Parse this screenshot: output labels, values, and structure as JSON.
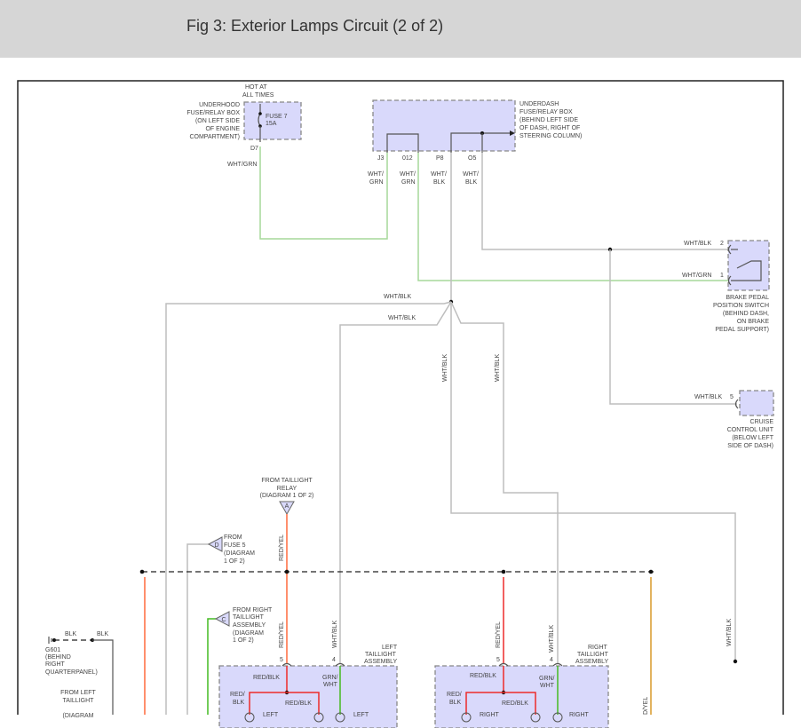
{
  "header": {
    "title": "Fig 3: Exterior Lamps Circuit (2 of 2)"
  },
  "diagram": {
    "underhood_box": {
      "hot": [
        "HOT AT",
        "ALL TIMES"
      ],
      "name": [
        "UNDERHOOD",
        "FUSE/RELAY BOX",
        "(ON LEFT SIDE",
        "OF ENGINE",
        "COMPARTMENT)"
      ],
      "fuse": [
        "FUSE 7",
        "15A"
      ],
      "pin": "D7",
      "wire": "WHT/GRN"
    },
    "underdash_box": {
      "name": [
        "UNDERDASH",
        "FUSE/RELAY BOX",
        "(BEHIND LEFT SIDE",
        "OF DASH, RIGHT OF",
        "STEERING COLUMN)"
      ],
      "pins": [
        {
          "pin": "J3",
          "wire": [
            "WHT/",
            "GRN"
          ]
        },
        {
          "pin": "012",
          "wire": [
            "WHT/",
            "GRN"
          ]
        },
        {
          "pin": "P8",
          "wire": [
            "WHT/",
            "BLK"
          ]
        },
        {
          "pin": "O5",
          "wire": [
            "WHT/",
            "BLK"
          ]
        }
      ]
    },
    "brake_switch": {
      "name": [
        "BRAKE PEDAL",
        "POSITION SWITCH",
        "(BEHIND DASH,",
        "ON BRAKE",
        "PEDAL SUPPORT)"
      ],
      "pin2_wire": "WHT/BLK",
      "pin2": "2",
      "pin1_wire": "WHT/GRN",
      "pin1": "1"
    },
    "cruise_unit": {
      "name": [
        "CRUISE",
        "CONTROL UNIT",
        "(BELOW LEFT",
        "SIDE OF DASH)"
      ],
      "wire": "WHT/BLK",
      "pin": "5"
    },
    "wire_labels": {
      "wht_blk_1": "WHT/BLK",
      "wht_blk_2": "WHT/BLK",
      "wht_blk_v1": "WHT/BLK",
      "wht_blk_v2": "WHT/BLK",
      "wht_blk_v3": "WHT/BLK",
      "wht_blk_v4": "WHT/BLK",
      "wht_blk_v5": "WHT/BLK",
      "red_yel_1": "RED/YEL",
      "red_yel_2": "RED/YEL",
      "red_yel_3": "RED/YEL",
      "red_yel_4": "D/YEL"
    },
    "connector_a": {
      "letter": "A",
      "text": [
        "FROM TAILLIGHT",
        "RELAY",
        "(DIAGRAM 1 OF 2)"
      ]
    },
    "connector_d": {
      "letter": "D",
      "text": [
        "FROM",
        "FUSE 5",
        "(DIAGRAM",
        "1 OF 2)"
      ]
    },
    "connector_c": {
      "letter": "C",
      "text": [
        "FROM RIGHT",
        "TAILLIGHT",
        "ASSEMBLY",
        "(DIAGRAM",
        "1 OF 2)"
      ]
    },
    "ground": {
      "wire1": "BLK",
      "wire2": "BLK",
      "name": [
        "G601",
        "(BEHIND",
        "RIGHT",
        "QUARTERPANEL)"
      ]
    },
    "from_left": {
      "text": [
        "FROM LEFT",
        "TAILLIGHT",
        "(DIAGRAM"
      ]
    },
    "left_taillight": {
      "name": [
        "LEFT",
        "TAILLIGHT",
        "ASSEMBLY"
      ],
      "pin5": "5",
      "pin4": "4",
      "red_blk_top": "RED/BLK",
      "red_blk_left": [
        "RED/",
        "BLK"
      ],
      "red_blk_mid": "RED/BLK",
      "grn_wht": [
        "GRN/",
        "WHT"
      ],
      "bulb1": "LEFT",
      "bulb2": "LEFT"
    },
    "right_taillight": {
      "name": [
        "RIGHT",
        "TAILLIGHT",
        "ASSEMBLY"
      ],
      "pin5": "5",
      "pin4": "4",
      "red_blk_top": "RED/BLK",
      "red_blk_left": [
        "RED/",
        "BLK"
      ],
      "red_blk_mid": "RED/BLK",
      "grn_wht": [
        "GRN/",
        "WHT"
      ],
      "bulb1": "RIGHT",
      "bulb2": "RIGHT"
    }
  }
}
